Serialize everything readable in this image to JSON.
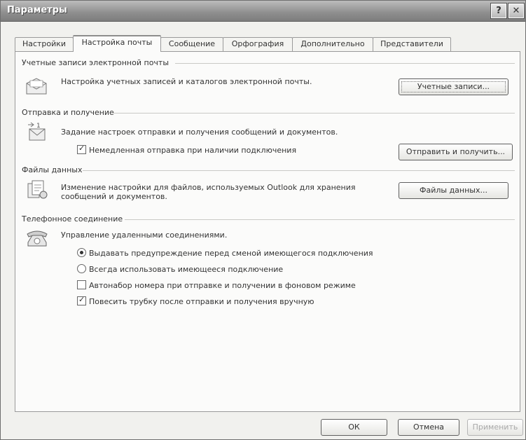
{
  "window": {
    "title": "Параметры",
    "help_label": "?",
    "close_label": "✕"
  },
  "tabs": [
    {
      "label": "Настройки",
      "active": false
    },
    {
      "label": "Настройка почты",
      "active": true
    },
    {
      "label": "Сообщение",
      "active": false
    },
    {
      "label": "Орфография",
      "active": false
    },
    {
      "label": "Дополнительно",
      "active": false
    },
    {
      "label": "Представители",
      "active": false
    }
  ],
  "accounts": {
    "title": "Учетные записи электронной почты",
    "description": "Настройка учетных записей и каталогов электронной почты.",
    "button": "Учетные записи..."
  },
  "send_receive": {
    "title": "Отправка и получение",
    "description": "Задание настроек отправки и получения сообщений и документов.",
    "immediate_send_label": "Немедленная отправка при наличии подключения",
    "immediate_send_checked": true,
    "button": "Отправить и получить..."
  },
  "data_files": {
    "title": "Файлы данных",
    "description_line1": "Изменение настройки для файлов, используемых Outlook для хранения",
    "description_line2": "сообщений и документов.",
    "button": "Файлы данных..."
  },
  "dialup": {
    "title": "Телефонное соединение",
    "description": "Управление удаленными соединениями.",
    "options": [
      {
        "label": "Выдавать предупреждение перед сменой имеющегося подключения",
        "type": "radio",
        "checked": true
      },
      {
        "label": "Всегда использовать имеющееся подключение",
        "type": "radio",
        "checked": false
      },
      {
        "label": "Автонабор номера при отправке и получении в фоновом режиме",
        "type": "checkbox",
        "checked": false
      },
      {
        "label": "Повесить трубку после отправки и получения вручную",
        "type": "checkbox",
        "checked": true
      }
    ]
  },
  "footer": {
    "ok": "ОК",
    "cancel": "Отмена",
    "apply": "Применить"
  }
}
